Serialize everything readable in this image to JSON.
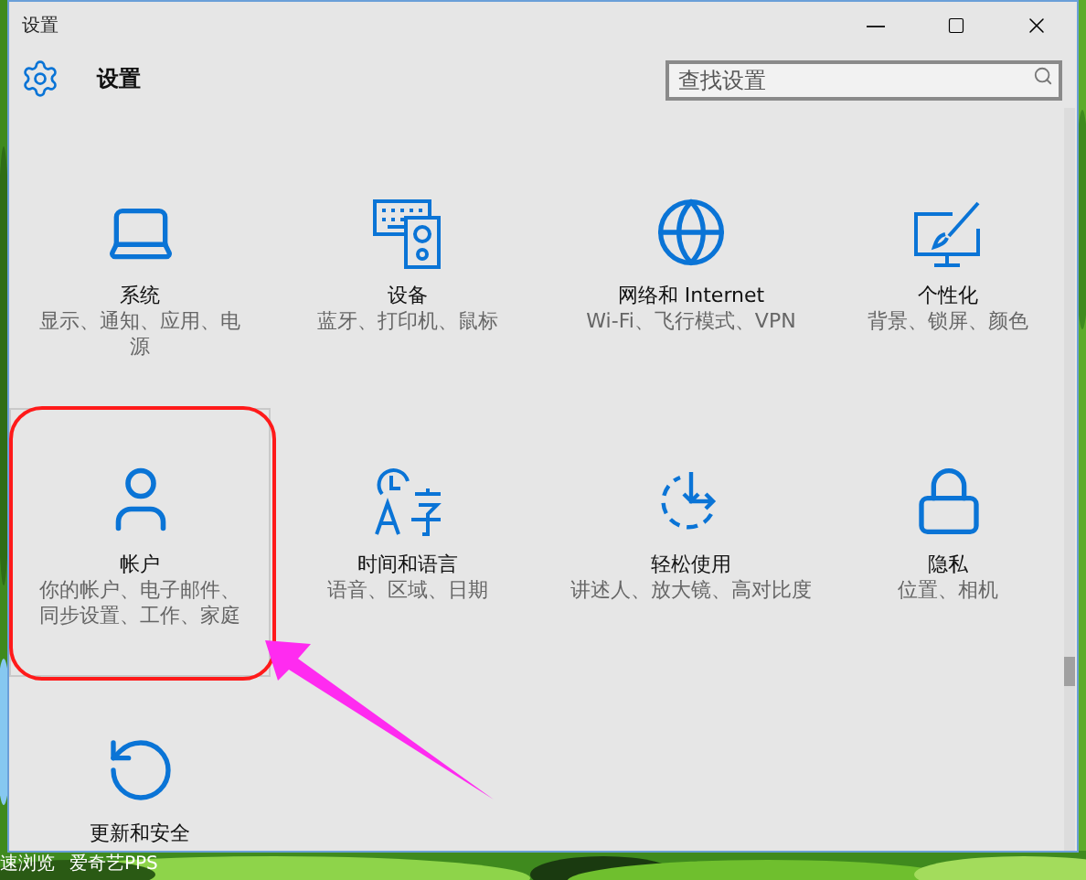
{
  "window": {
    "title": "设置"
  },
  "header": {
    "title": "设置"
  },
  "search": {
    "placeholder": "查找设置"
  },
  "tiles": [
    {
      "kind": "laptop",
      "title": "系统",
      "description": "显示、通知、应用、电源",
      "selected": false
    },
    {
      "kind": "devices",
      "title": "设备",
      "description": "蓝牙、打印机、鼠标",
      "selected": false
    },
    {
      "kind": "globe",
      "title": "网络和 Internet",
      "description": "Wi-Fi、飞行模式、VPN",
      "selected": false
    },
    {
      "kind": "personalize",
      "title": "个性化",
      "description": "背景、锁屏、颜色",
      "selected": false
    },
    {
      "kind": "person",
      "title": "帐户",
      "description": "你的帐户、电子邮件、同步设置、工作、家庭",
      "selected": true
    },
    {
      "kind": "language",
      "title": "时间和语言",
      "description": "语音、区域、日期",
      "selected": false
    },
    {
      "kind": "ease",
      "title": "轻松使用",
      "description": "讲述人、放大镜、高对比度",
      "selected": false
    },
    {
      "kind": "lock",
      "title": "隐私",
      "description": "位置、相机",
      "selected": false
    },
    {
      "kind": "update",
      "title": "更新和安全",
      "selected": false
    }
  ],
  "desktop_icons": [
    {
      "label": "速浏览"
    },
    {
      "label": "爱奇艺PPS"
    }
  ]
}
